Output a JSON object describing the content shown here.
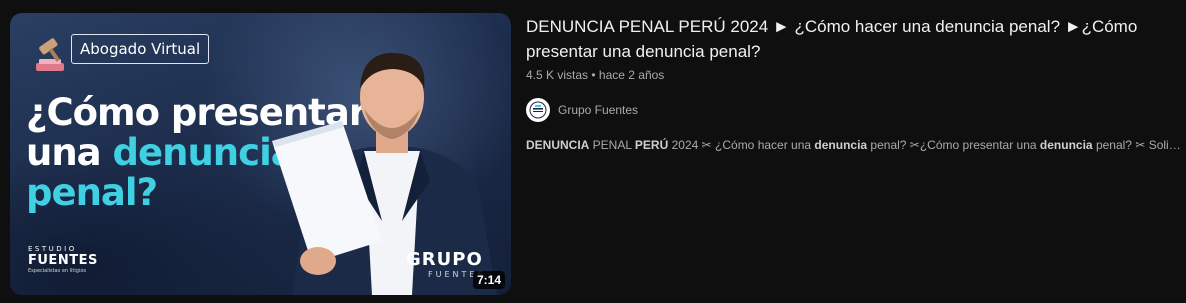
{
  "thumbnail": {
    "channel_pill": "Abogado Virtual",
    "headline_line1": "¿Cómo presentar",
    "headline_line2_a": "una ",
    "headline_line2_b": "denuncia",
    "headline_line3": "penal?",
    "brand_left_small": "ESTUDIO",
    "brand_left_big": "FUENTES",
    "brand_left_tiny": "Especialistas en litigios",
    "brand_right": "GRUPO",
    "brand_right_sub": "FUENTES",
    "duration": "7:14",
    "accent_color": "#3fd0e3"
  },
  "video": {
    "title": "DENUNCIA PENAL PERÚ 2024 ► ¿Cómo hacer una denuncia penal? ►¿Cómo presentar una denuncia penal?",
    "views": "4.5 K vistas",
    "separator": " • ",
    "age": "hace 2 años"
  },
  "channel": {
    "avatar_text": "GRUPO FUENTES",
    "name": "Grupo Fuentes"
  },
  "description": {
    "parts": [
      {
        "bold": true,
        "text": "DENUNCIA"
      },
      {
        "bold": false,
        "text": " PENAL "
      },
      {
        "bold": true,
        "text": "PERÚ"
      },
      {
        "bold": false,
        "text": " 2024 ✂ ¿Cómo hacer una "
      },
      {
        "bold": true,
        "text": "denuncia"
      },
      {
        "bold": false,
        "text": " penal? ✂¿Cómo presentar una "
      },
      {
        "bold": true,
        "text": "denuncia"
      },
      {
        "bold": false,
        "text": " penal? ✂ Solicita un ..."
      }
    ]
  }
}
